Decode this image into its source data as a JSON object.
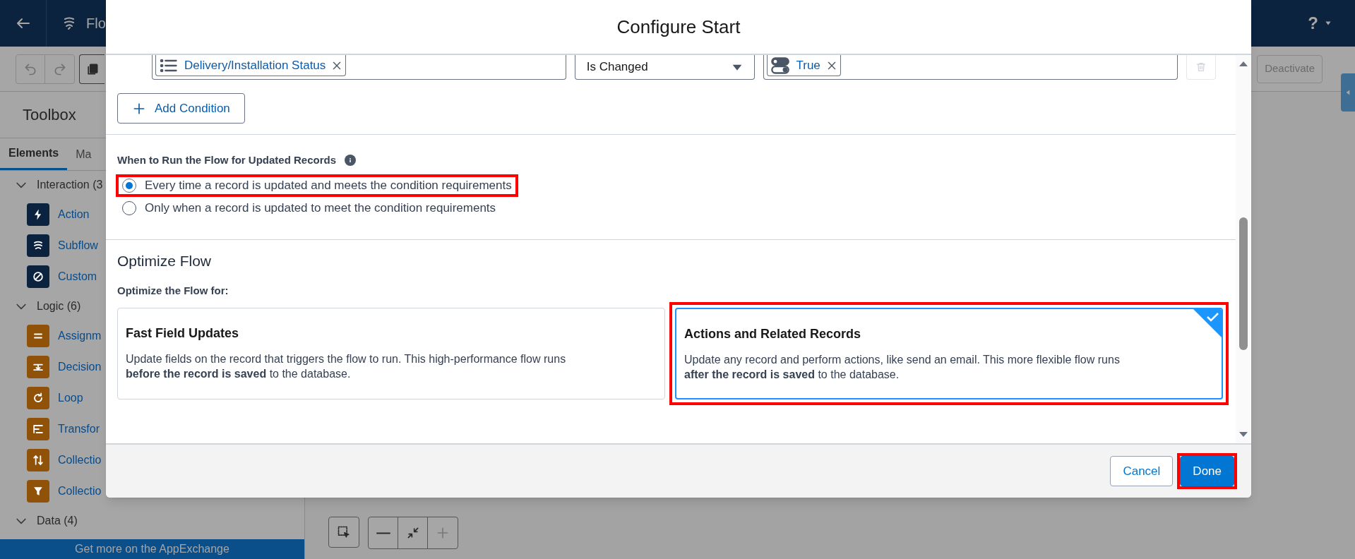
{
  "app_bar": {
    "title": "Flo",
    "help": "?"
  },
  "toolbar": {
    "deactivate": "Deactivate"
  },
  "toolbox": {
    "title": "Toolbox",
    "tabs": [
      {
        "label": "Elements",
        "selected": true
      },
      {
        "label": "Ma",
        "selected": false
      }
    ],
    "groups": [
      {
        "label": "Interaction (3",
        "expanded": true,
        "color": "#0c2340",
        "items": [
          {
            "label": "Action"
          },
          {
            "label": "Subflow"
          },
          {
            "label": "Custom"
          }
        ]
      },
      {
        "label": "Logic (6)",
        "expanded": true,
        "color": "#8f5208",
        "items": [
          {
            "label": "Assignm"
          },
          {
            "label": "Decision"
          },
          {
            "label": "Loop"
          },
          {
            "label": "Transfor"
          },
          {
            "label": "Collectio"
          },
          {
            "label": "Collectio"
          }
        ]
      },
      {
        "label": "Data (4)",
        "expanded": true
      }
    ],
    "appexchange": "Get more on the AppExchange"
  },
  "modal": {
    "title": "Configure Start",
    "condition": {
      "field": "Delivery/Installation Status",
      "operator": "Is Changed",
      "value": "True"
    },
    "add_condition": "Add Condition",
    "run_section": {
      "label": "When to Run the Flow for Updated Records",
      "options": [
        {
          "label": "Every time a record is updated and meets the condition requirements",
          "selected": true,
          "highlighted": true
        },
        {
          "label": "Only when a record is updated to meet the condition requirements",
          "selected": false,
          "highlighted": false
        }
      ]
    },
    "optimize": {
      "heading": "Optimize Flow",
      "label": "Optimize the Flow for:",
      "options": [
        {
          "title": "Fast Field Updates",
          "description": "Update fields on the record that triggers the flow to run. This high-performance flow runs\n**before the record is saved** to the database.",
          "selected": false,
          "highlighted": false
        },
        {
          "title": "Actions and Related Records",
          "description": "Update any record and perform actions, like send an email. This more flexible flow runs\n**after the record is saved** to the database.",
          "selected": true,
          "highlighted": true
        }
      ]
    },
    "buttons": [
      {
        "label": "Cancel",
        "kind": "neutral",
        "highlighted": false
      },
      {
        "label": "Done",
        "kind": "brand",
        "highlighted": true
      }
    ]
  }
}
